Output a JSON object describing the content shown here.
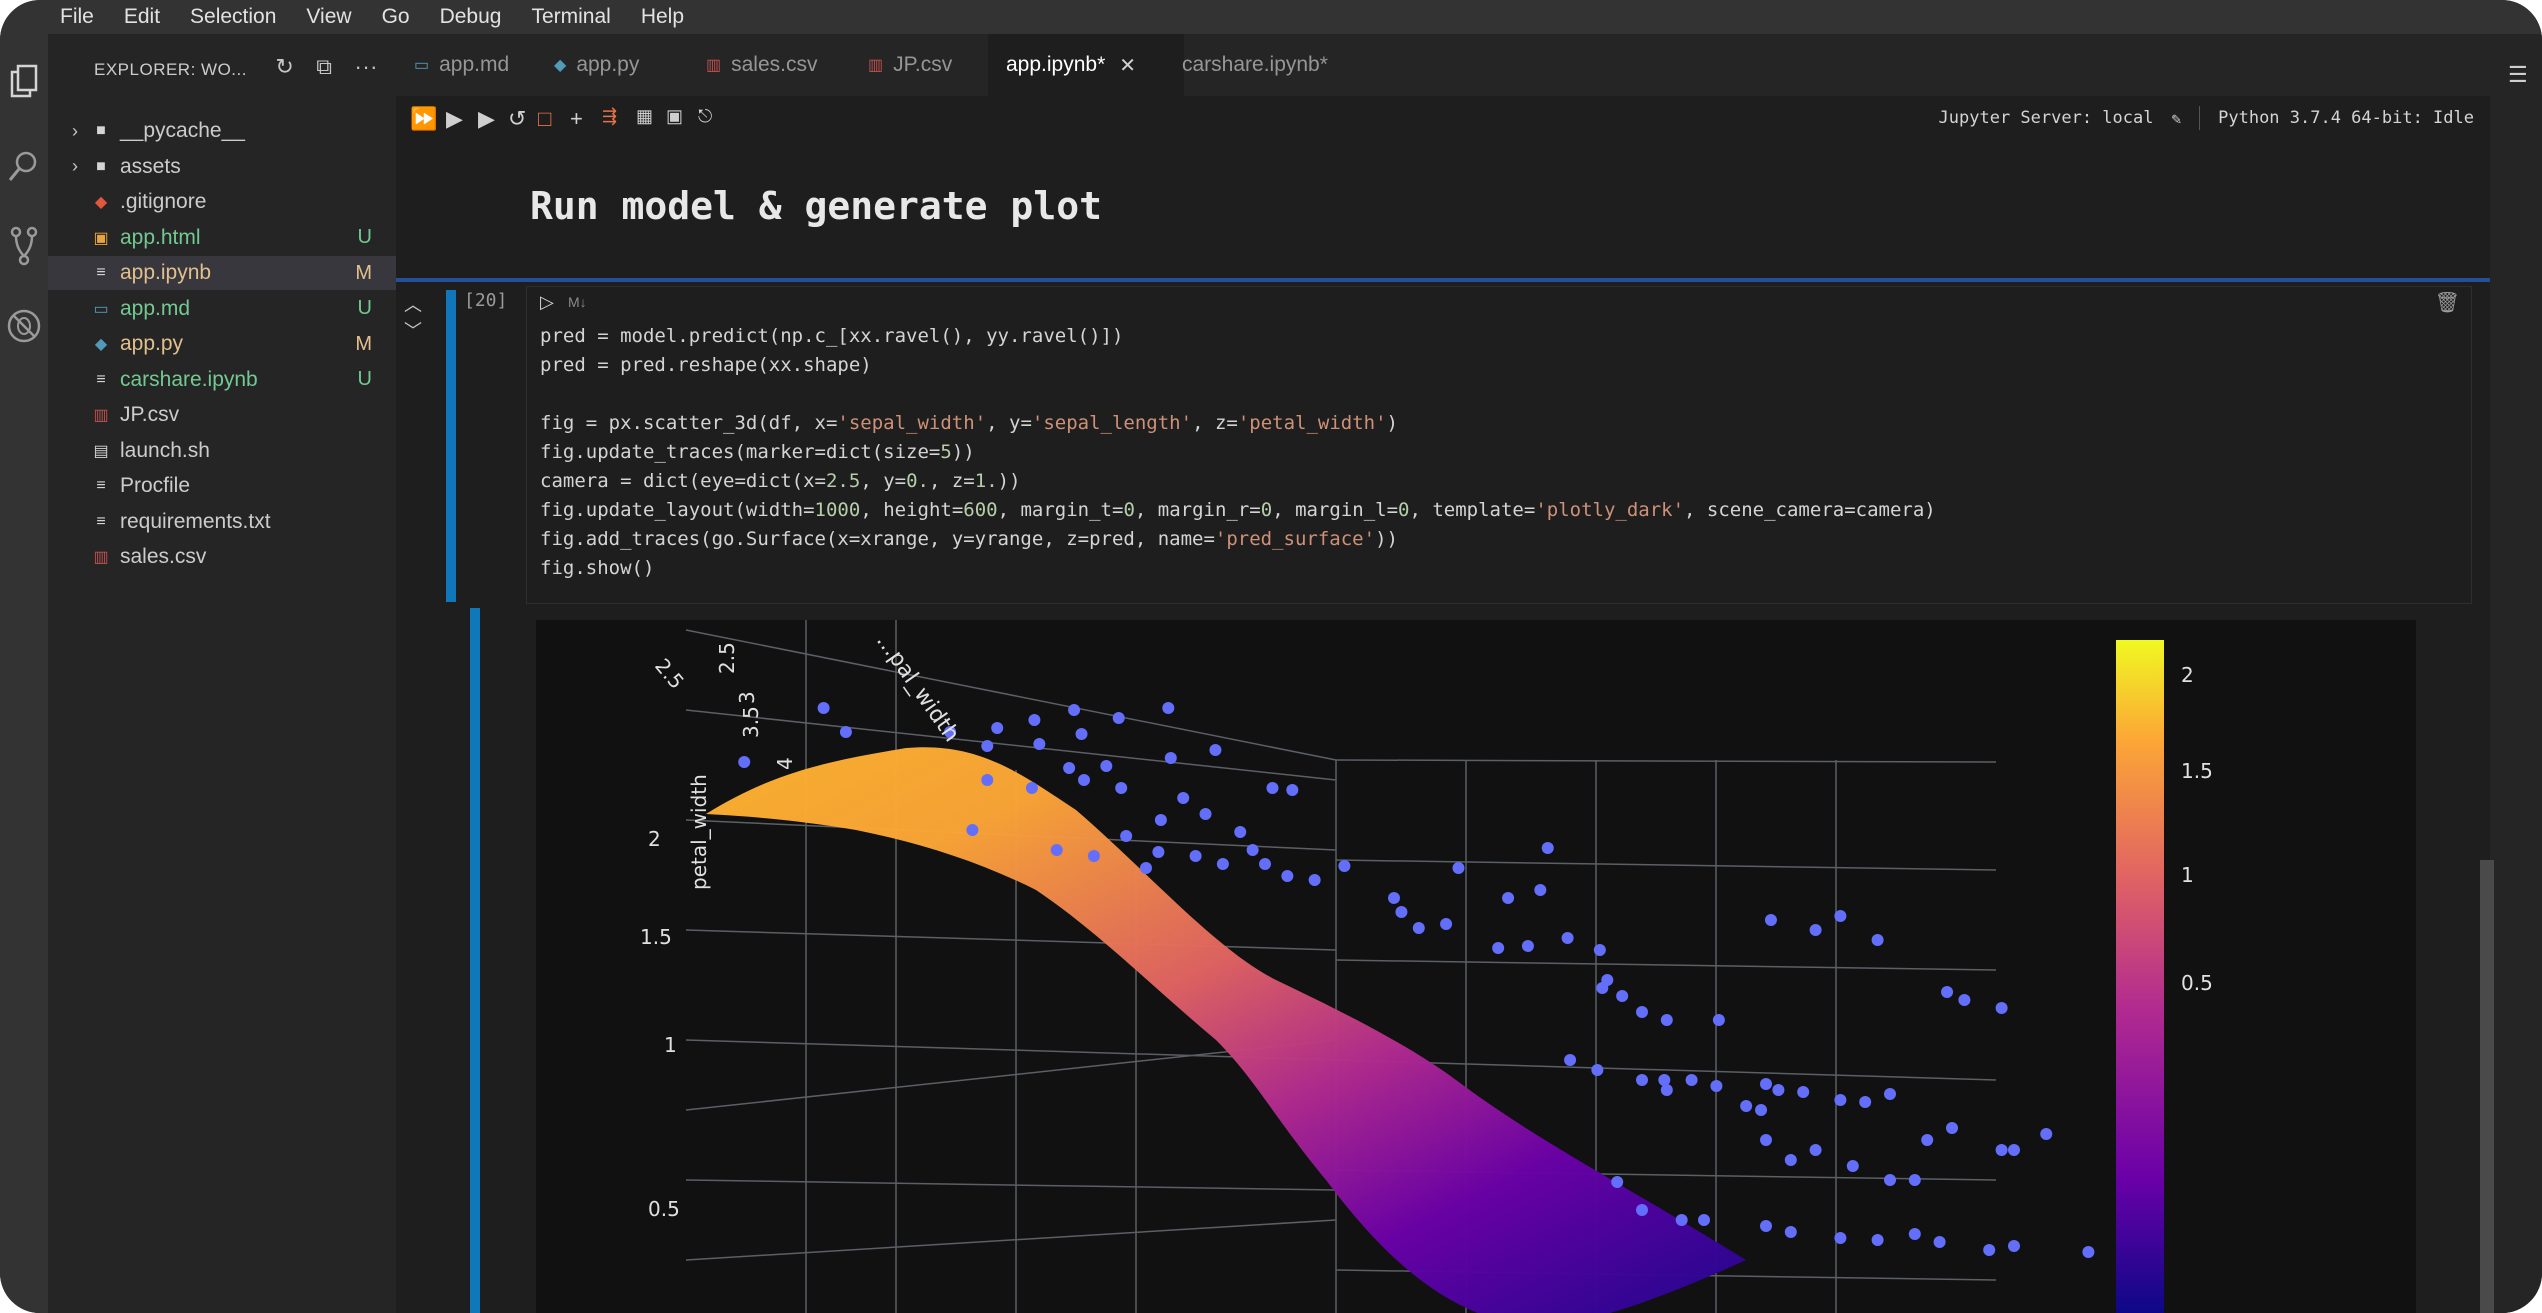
{
  "menu": [
    "File",
    "Edit",
    "Selection",
    "View",
    "Go",
    "Debug",
    "Terminal",
    "Help"
  ],
  "explorer": {
    "title": "EXPLORER: WO...",
    "items": [
      {
        "name": "__pycache__",
        "type": "folder",
        "status": ""
      },
      {
        "name": "assets",
        "type": "folder",
        "status": ""
      },
      {
        "name": ".gitignore",
        "type": "git",
        "status": ""
      },
      {
        "name": "app.html",
        "type": "html",
        "status": "U"
      },
      {
        "name": "app.ipynb",
        "type": "ipynb",
        "status": "M"
      },
      {
        "name": "app.md",
        "type": "md",
        "status": "U"
      },
      {
        "name": "app.py",
        "type": "py",
        "status": "M"
      },
      {
        "name": "carshare.ipynb",
        "type": "ipynb",
        "status": "U"
      },
      {
        "name": "JP.csv",
        "type": "csv",
        "status": ""
      },
      {
        "name": "launch.sh",
        "type": "sh",
        "status": ""
      },
      {
        "name": "Procfile",
        "type": "txt",
        "status": ""
      },
      {
        "name": "requirements.txt",
        "type": "txt",
        "status": ""
      },
      {
        "name": "sales.csv",
        "type": "csv",
        "status": ""
      }
    ]
  },
  "tabs": [
    {
      "label": "app.md",
      "icon": "md"
    },
    {
      "label": "app.py",
      "icon": "py"
    },
    {
      "label": "sales.csv",
      "icon": "csv"
    },
    {
      "label": "JP.csv",
      "icon": "csv"
    },
    {
      "label": "app.ipynb*",
      "icon": "",
      "active": true
    },
    {
      "label": "carshare.ipynb*",
      "icon": ""
    }
  ],
  "toolbar": {
    "jupyter_server": "Jupyter Server: local",
    "kernel": "Python 3.7.4 64-bit: Idle"
  },
  "notebook": {
    "heading": "Run model & generate plot",
    "cell_prompt": "[20]",
    "md_label": "M↓",
    "code": [
      "pred = model.predict(np.c_[xx.ravel(), yy.ravel()])",
      "pred = pred.reshape(xx.shape)",
      "",
      "fig = px.scatter_3d(df, x='sepal_width', y='sepal_length', z='petal_width')",
      "fig.update_traces(marker=dict(size=5))",
      "camera = dict(eye=dict(x=2.5, y=0., z=1.))",
      "fig.update_layout(width=1000, height=600, margin_t=0, margin_r=0, margin_l=0, template='plotly_dark', scene_camera=camera)",
      "fig.add_traces(go.Surface(x=xrange, y=yrange, z=pred, name='pred_surface'))",
      "fig.show()"
    ]
  },
  "chart_data": {
    "type": "scatter",
    "title": "",
    "axis_z_label": "petal_width",
    "axis_x_label": "...pal_width",
    "z_ticks": [
      "0.5",
      "1",
      "1.5",
      "2"
    ],
    "x_ticks": [
      "2.5",
      "3",
      "3.5",
      "4"
    ],
    "corner_tick": "2.5",
    "colorbar_ticks": [
      "0.5",
      "1",
      "1.5",
      "2"
    ],
    "colorscale": [
      "#0d0887",
      "#6a00a8",
      "#b12a90",
      "#e16462",
      "#fca636",
      "#f0f921"
    ],
    "marker_color": "#636efa",
    "surface_name": "pred_surface"
  }
}
